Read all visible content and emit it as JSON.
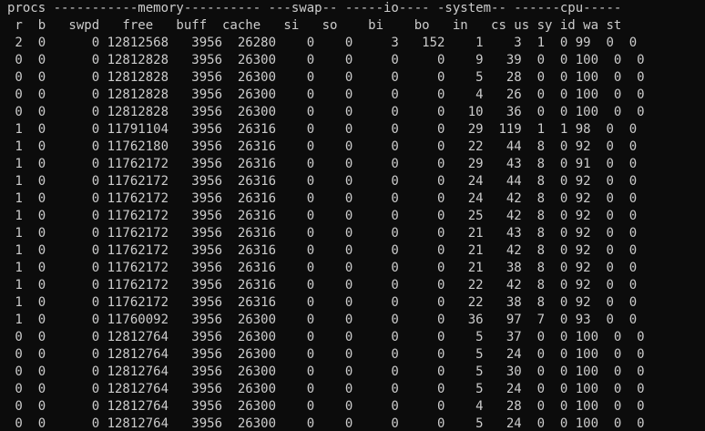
{
  "terminal": {
    "lines": [
      "procs -----------memory---------- ---swap-- -----io---- -system-- ------cpu-----",
      " r  b   swpd   free   buff  cache   si   so    bi    bo   in   cs us sy id wa st",
      " 2  0      0 12812568   3956  26280    0    0     3   152    1    3  1  0 99  0  0",
      " 0  0      0 12812828   3956  26300    0    0     0     0    9   39  0  0 100  0  0",
      " 0  0      0 12812828   3956  26300    0    0     0     0    5   28  0  0 100  0  0",
      " 0  0      0 12812828   3956  26300    0    0     0     0    4   26  0  0 100  0  0",
      " 0  0      0 12812828   3956  26300    0    0     0     0   10   36  0  0 100  0  0",
      " 1  0      0 11791104   3956  26316    0    0     0     0   29  119  1  1 98  0  0",
      " 1  0      0 11762180   3956  26316    0    0     0     0   22   44  8  0 92  0  0",
      " 1  0      0 11762172   3956  26316    0    0     0     0   29   43  8  0 91  0  0",
      " 1  0      0 11762172   3956  26316    0    0     0     0   24   44  8  0 92  0  0",
      " 1  0      0 11762172   3956  26316    0    0     0     0   24   42  8  0 92  0  0",
      " 1  0      0 11762172   3956  26316    0    0     0     0   25   42  8  0 92  0  0",
      " 1  0      0 11762172   3956  26316    0    0     0     0   21   43  8  0 92  0  0",
      " 1  0      0 11762172   3956  26316    0    0     0     0   21   42  8  0 92  0  0",
      " 1  0      0 11762172   3956  26316    0    0     0     0   21   38  8  0 92  0  0",
      " 1  0      0 11762172   3956  26316    0    0     0     0   22   42  8  0 92  0  0",
      " 1  0      0 11762172   3956  26316    0    0     0     0   22   38  8  0 92  0  0",
      " 1  0      0 11760092   3956  26300    0    0     0     0   36   97  7  0 93  0  0",
      " 0  0      0 12812764   3956  26300    0    0     0     0    5   37  0  0 100  0  0",
      " 0  0      0 12812764   3956  26300    0    0     0     0    5   24  0  0 100  0  0",
      " 0  0      0 12812764   3956  26300    0    0     0     0    5   30  0  0 100  0  0",
      " 0  0      0 12812764   3956  26300    0    0     0     0    5   24  0  0 100  0  0",
      " 0  0      0 12812764   3956  26300    0    0     0     0    4   28  0  0 100  0  0",
      " 0  0      0 12812764   3956  26300    0    0     0     0    5   24  0  0 100  0  0"
    ]
  }
}
